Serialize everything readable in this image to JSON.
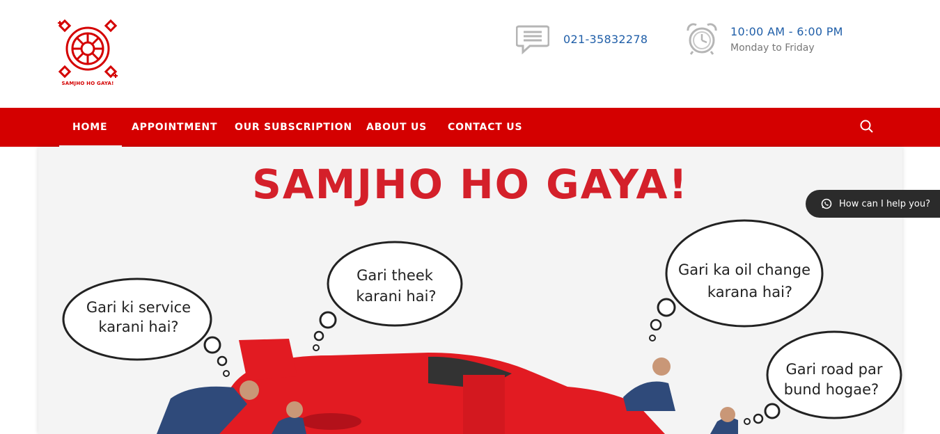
{
  "logo": {
    "text": "SAMJHO HO GAYA!"
  },
  "contact": {
    "phone": "021-35832278",
    "hours": "10:00 AM - 6:00 PM",
    "days": "Monday to Friday"
  },
  "nav": {
    "items": [
      {
        "label": "HOME"
      },
      {
        "label": "APPOINTMENT"
      },
      {
        "label": "OUR SUBSCRIPTION"
      },
      {
        "label": "ABOUT US"
      },
      {
        "label": "CONTACT US"
      }
    ]
  },
  "banner": {
    "title": "SAMJHO HO GAYA!",
    "bubbles": [
      {
        "line1": "Gari ki service",
        "line2": "karani hai?"
      },
      {
        "line1": "Gari theek",
        "line2": "karani hai?"
      },
      {
        "line1": "Gari ka oil change",
        "line2": "karana hai?"
      },
      {
        "line1": "Gari road par",
        "line2": "bund hogae?"
      }
    ]
  },
  "help_widget": {
    "label": "How can I help you?"
  },
  "colors": {
    "brand_red": "#d40000",
    "link_blue": "#1f5ea8",
    "widget_dark": "#2b2b2b"
  }
}
